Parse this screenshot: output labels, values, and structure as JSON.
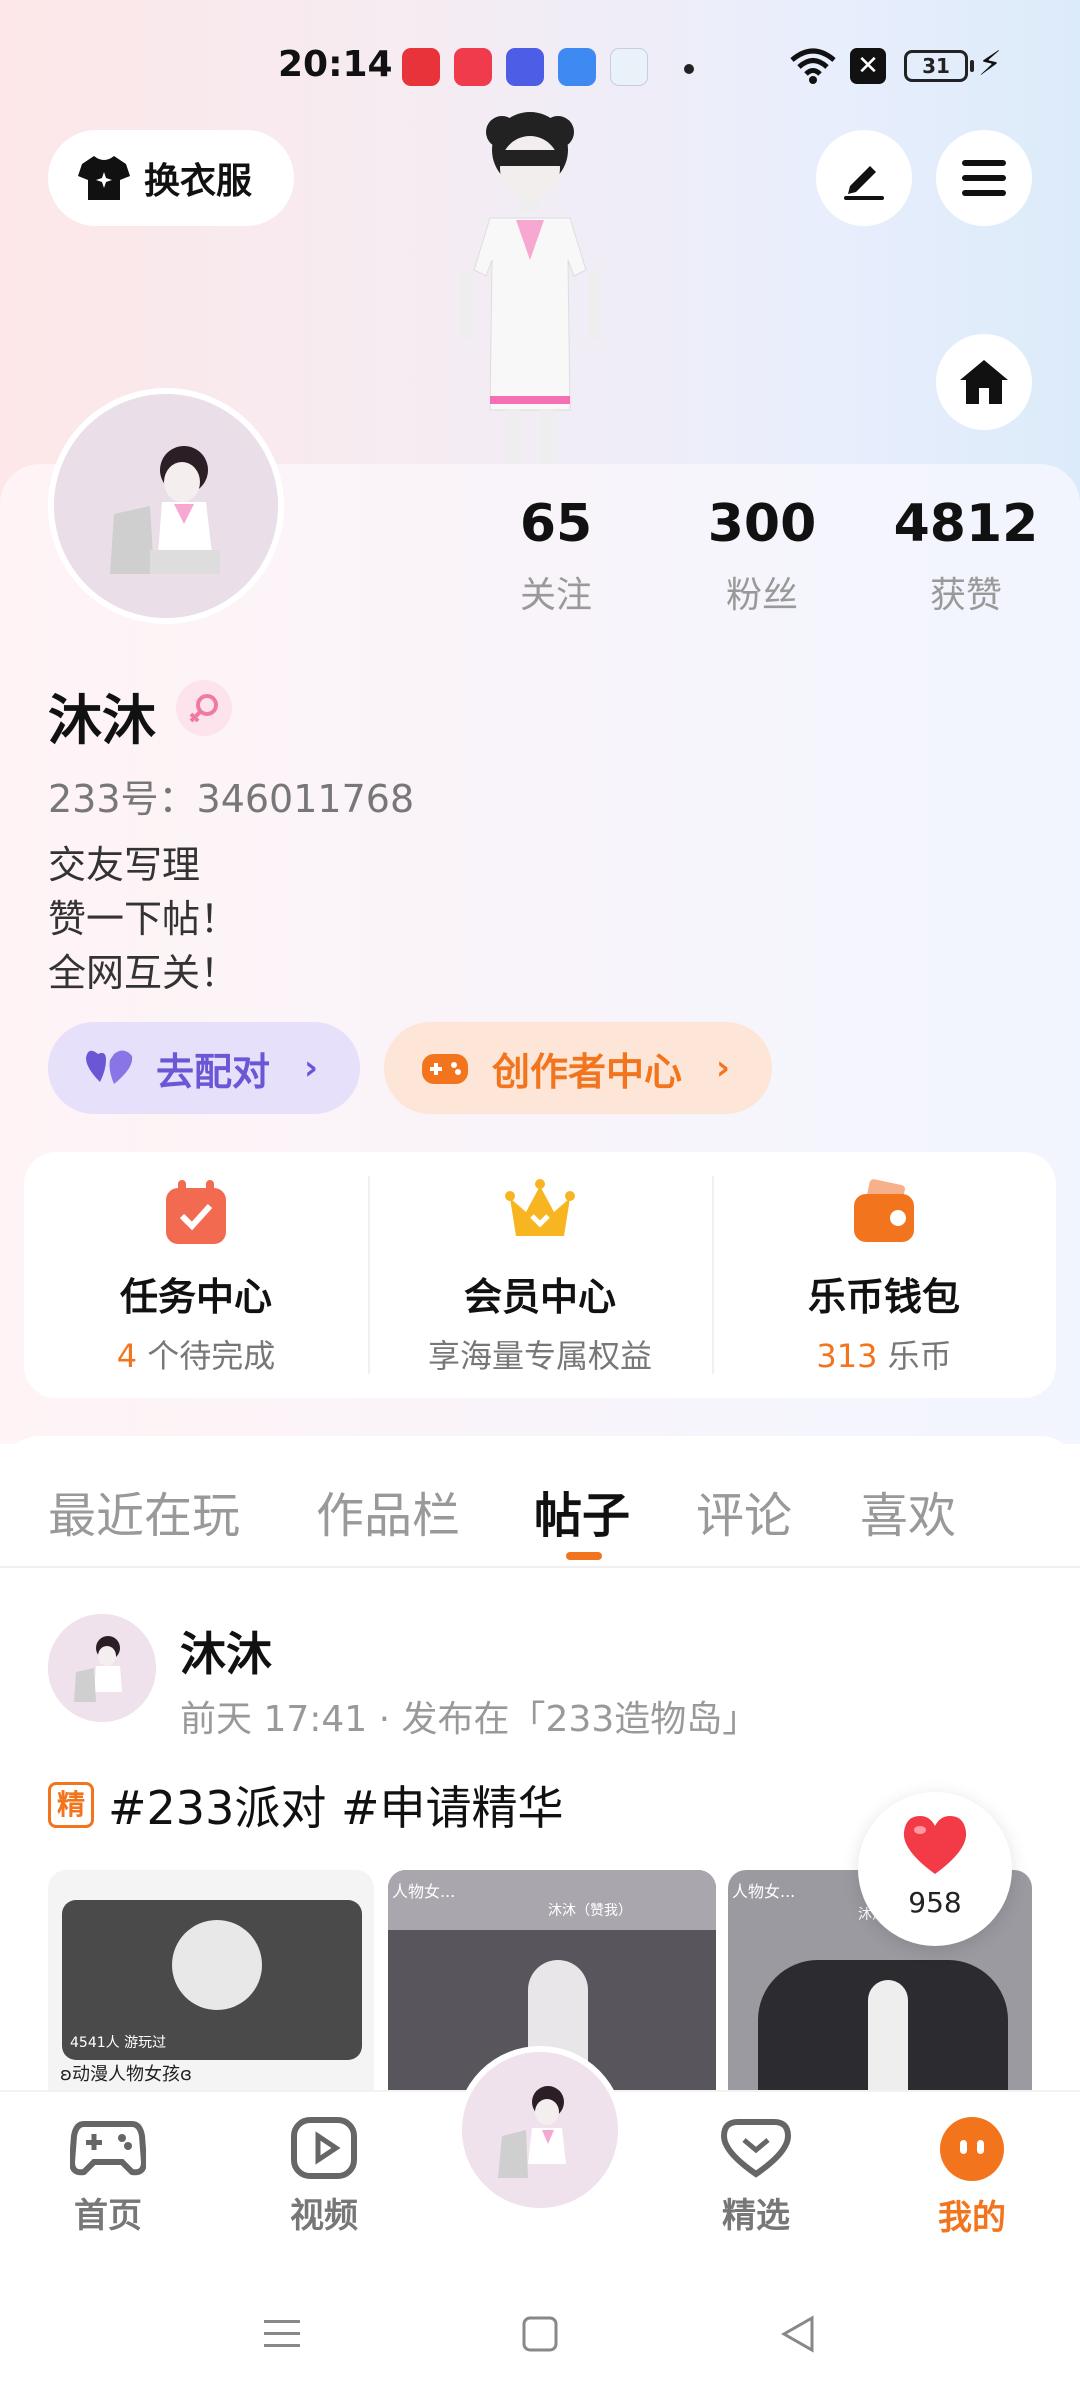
{
  "status_bar": {
    "time": "20:14",
    "battery": "31",
    "app_icons": [
      "red-app-icon",
      "video-app-icon",
      "weather-app-icon",
      "blue-app-icon",
      "game-app-icon"
    ]
  },
  "header": {
    "outfit_label": "换衣服"
  },
  "profile": {
    "stats": [
      {
        "value": "65",
        "label": "关注"
      },
      {
        "value": "300",
        "label": "粉丝"
      },
      {
        "value": "4812",
        "label": "获赞"
      }
    ],
    "nickname": "沐沐",
    "user_id": "233号：346011768",
    "bio": [
      "交友写理",
      "赞一下帖！",
      "全网互关！"
    ],
    "match_label": "去配对",
    "creator_label": "创作者中心"
  },
  "features": [
    {
      "title": "任务中心",
      "sub_accent": "4",
      "sub_text": " 个待完成"
    },
    {
      "title": "会员中心",
      "sub_accent": "",
      "sub_text": "享海量专属权益"
    },
    {
      "title": "乐币钱包",
      "sub_accent": "313",
      "sub_text": " 乐币"
    }
  ],
  "tabs": [
    "最近在玩",
    "作品栏",
    "帖子",
    "评论",
    "喜欢"
  ],
  "active_tab": "帖子",
  "post": {
    "author": "沐沐",
    "meta": "前天 17:41 · 发布在「233造物岛」",
    "essence": "精",
    "hashtags": "#233派对 #申请精华",
    "thumb_captions": [
      "ʚ动漫人物女孩ɞ",
      "人物女...",
      "沐沐（赞我）",
      "人物女...",
      "沐沐（赞我）"
    ],
    "thumb_overlay": "4541人 游玩过",
    "likes": "958"
  },
  "bottom_nav": [
    {
      "label": "首页"
    },
    {
      "label": "视频"
    },
    {
      "label": "精选"
    },
    {
      "label": "我的"
    }
  ],
  "colors": {
    "accent": "#f2751e",
    "purple": "#6b56d6"
  }
}
